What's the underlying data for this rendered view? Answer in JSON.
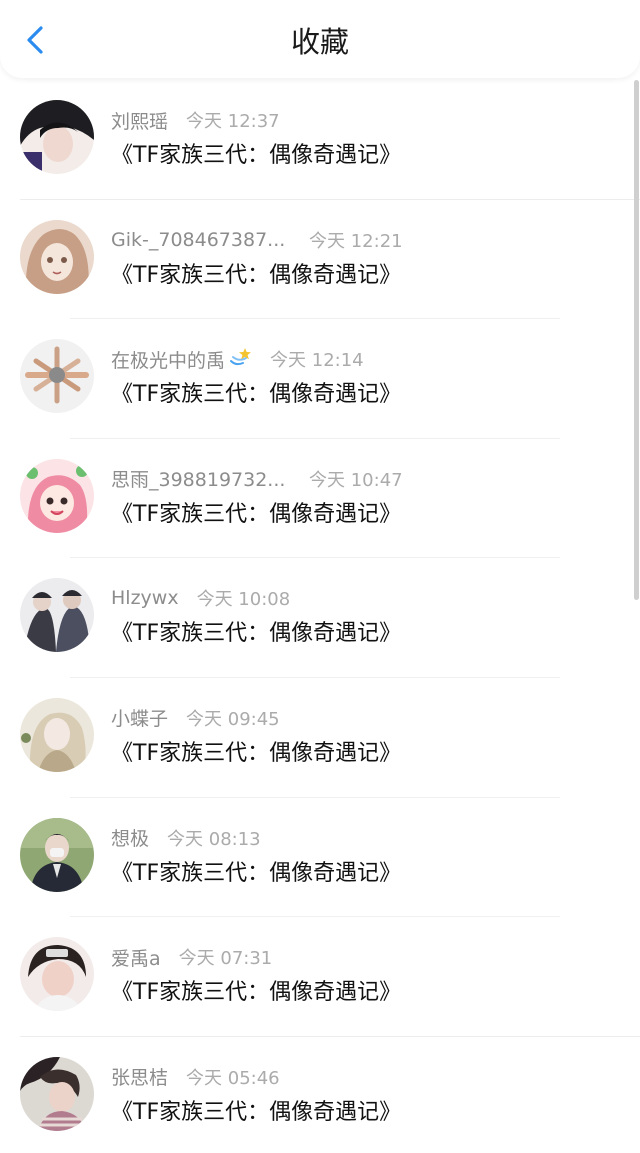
{
  "header": {
    "title": "收藏",
    "back_icon": "chevron-left-icon",
    "accent": "#2b8cf0"
  },
  "items": [
    {
      "username": "刘熙瑶",
      "time": "今天 12:37",
      "title": "《TF家族三代：偶像奇遇记》",
      "avatar_palette": [
        "#2a2a2a",
        "#e9d6d2",
        "#3b2f6b"
      ]
    },
    {
      "username": "Gik-_708467387...",
      "time": "今天 12:21",
      "title": "《TF家族三代：偶像奇遇记》",
      "avatar_palette": [
        "#e8d2c4",
        "#c49b84",
        "#7b5a4a"
      ]
    },
    {
      "username": "在极光中的禹",
      "time": "今天 12:14",
      "title": "《TF家族三代：偶像奇遇记》",
      "avatar_palette": [
        "#f2f2f2",
        "#d6a88a",
        "#8a8a8a"
      ]
    },
    {
      "username": "思雨_398819732...",
      "time": "今天 10:47",
      "title": "《TF家族三代：偶像奇遇记》",
      "avatar_palette": [
        "#f7c9cf",
        "#ee8aa0",
        "#6bbf6f"
      ]
    },
    {
      "username": "Hlzywx",
      "time": "今天 10:08",
      "title": "《TF家族三代：偶像奇遇记》",
      "avatar_palette": [
        "#e7e7ea",
        "#3b3b45",
        "#9aa0b4"
      ]
    },
    {
      "username": "小蝶子",
      "time": "今天 09:45",
      "title": "《TF家族三代：偶像奇遇记》",
      "avatar_palette": [
        "#e9e4d8",
        "#b9a98a",
        "#5a5444"
      ]
    },
    {
      "username": "想极",
      "time": "今天 08:13",
      "title": "《TF家族三代：偶像奇遇记》",
      "avatar_palette": [
        "#9bb27d",
        "#2a2d3a",
        "#e7e7e7"
      ]
    },
    {
      "username": "爱禹a",
      "time": "今天 07:31",
      "title": "《TF家族三代：偶像奇遇记》",
      "avatar_palette": [
        "#f1e6e4",
        "#2c2422",
        "#e9c7bf"
      ]
    },
    {
      "username": "张思桔",
      "time": "今天 05:46",
      "title": "《TF家族三代：偶像奇遇记》",
      "avatar_palette": [
        "#dad7d2",
        "#3a2f2c",
        "#b27c8f"
      ]
    }
  ]
}
